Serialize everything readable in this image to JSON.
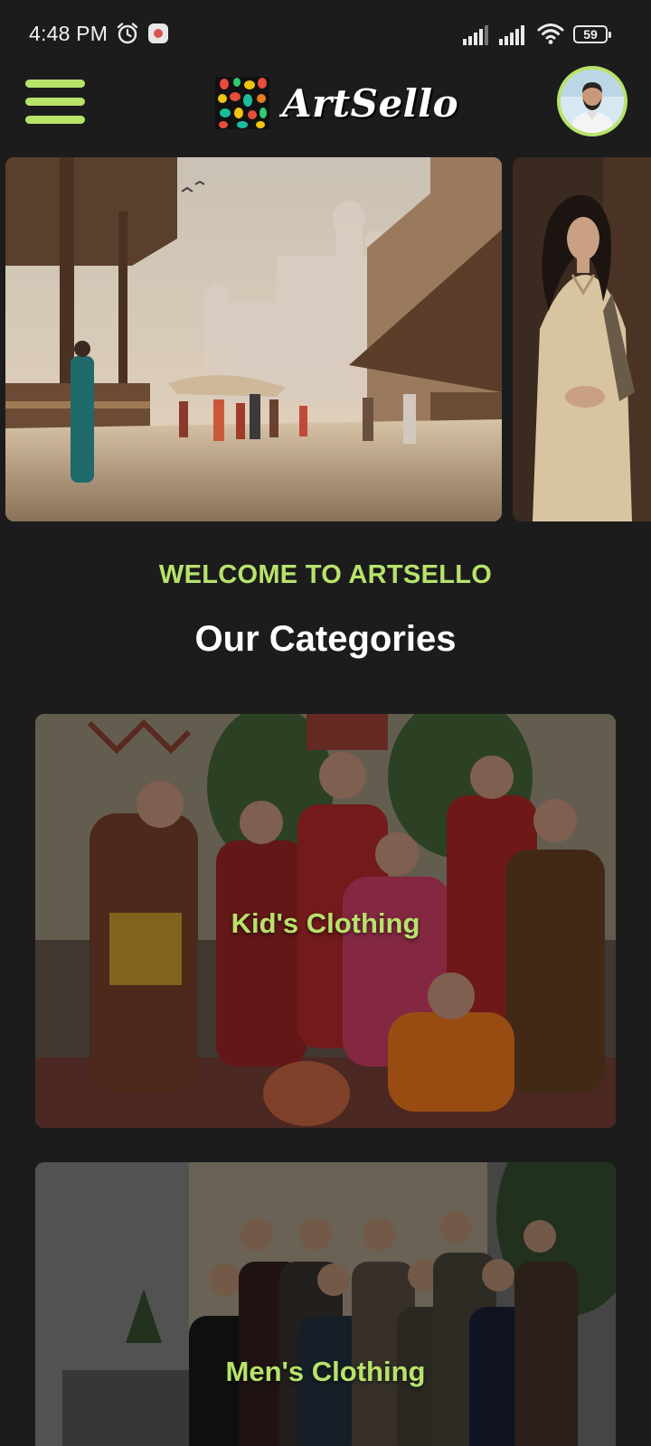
{
  "status_bar": {
    "time": "4:48 PM",
    "battery_level": "59",
    "icons": [
      "alarm-icon",
      "app-notification-icon",
      "signal-icon",
      "signal-icon",
      "wifi-icon",
      "battery-icon"
    ]
  },
  "header": {
    "menu_icon": "menu-icon",
    "logo_text": "ArtSello",
    "avatar_icon": "avatar"
  },
  "carousel": {
    "slides": [
      "bazaar-scene",
      "woman-in-kurta"
    ]
  },
  "main": {
    "welcome": "WELCOME TO ARTSELLO",
    "title": "Our Categories",
    "categories": [
      {
        "label": "Kid's Clothing"
      },
      {
        "label": "Men's Clothing"
      }
    ]
  },
  "colors": {
    "background": "#1c1c1c",
    "accent": "#b7e36b",
    "text": "#ffffff"
  }
}
